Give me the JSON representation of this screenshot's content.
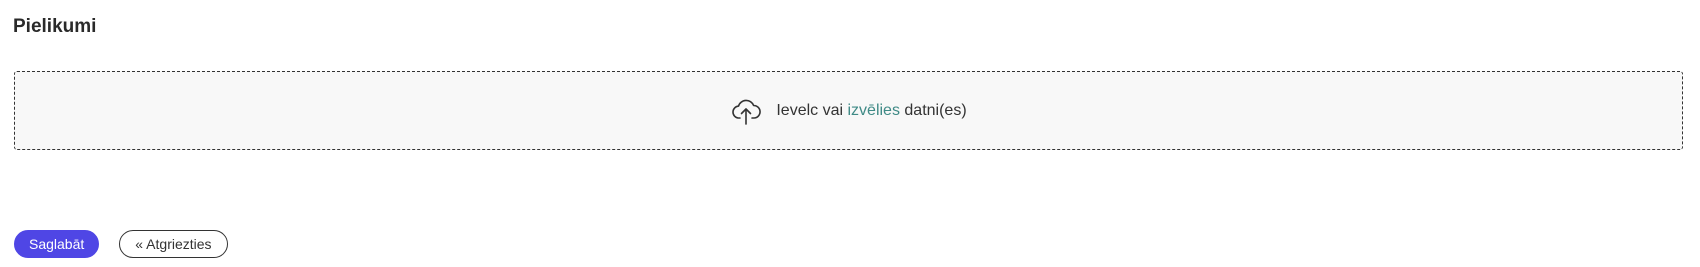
{
  "section": {
    "title": "Pielikumi"
  },
  "dropzone": {
    "icon": "cloud-upload-icon",
    "text_before": "Ievelc vai ",
    "link_text": "izvēlies",
    "text_after": " datni(es)",
    "link_color": "#3f8a86"
  },
  "actions": {
    "save_label": "Saglabāt",
    "back_label": "« Atgriezties",
    "primary_color": "#4f46e5"
  }
}
